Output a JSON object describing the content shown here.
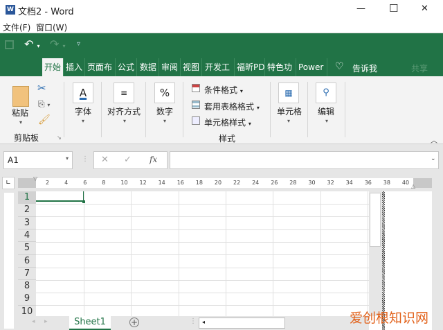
{
  "window": {
    "title": "文档2 - Word",
    "app_icon": "word-icon",
    "minimize": "—",
    "maximize": "☐",
    "close": "✕"
  },
  "menu": {
    "file": "文件(F)",
    "window": "窗口(W)"
  },
  "qat": {
    "save_icon": "save-icon",
    "undo_icon": "undo-icon",
    "redo_icon": "redo-icon",
    "customize_icon": "customize-icon"
  },
  "tabs": [
    "开始",
    "插入",
    "页面布",
    "公式",
    "数据",
    "审阅",
    "视图",
    "开发工",
    "福昕PD",
    "特色功",
    "Power"
  ],
  "tell_me": "告诉我",
  "share": "共享",
  "ribbon": {
    "paste": "粘贴",
    "clipboard": "剪贴板",
    "font": "字体",
    "alignment": "对齐方式",
    "number": "数字",
    "number_icon": "%",
    "font_icon": "A",
    "cond_format": "条件格式",
    "table_format": "套用表格格式",
    "cell_styles": "单元格样式",
    "styles": "样式",
    "cells": "单元格",
    "editing": "编辑"
  },
  "formula_bar": {
    "name_box": "A1",
    "fx": "fx",
    "value": ""
  },
  "ruler": {
    "marks": [
      "2",
      "4",
      "6",
      "8",
      "10",
      "12",
      "14",
      "16",
      "18",
      "20",
      "22",
      "24",
      "26",
      "28",
      "30",
      "32",
      "34",
      "36",
      "38",
      "40"
    ]
  },
  "rows": [
    "1",
    "2",
    "3",
    "4",
    "5",
    "6",
    "7",
    "8",
    "9",
    "10"
  ],
  "sheet_tab": "Sheet1",
  "watermark": "爱创根知识网",
  "colors": {
    "accent": "#217346",
    "watermark": "#e2621b"
  }
}
